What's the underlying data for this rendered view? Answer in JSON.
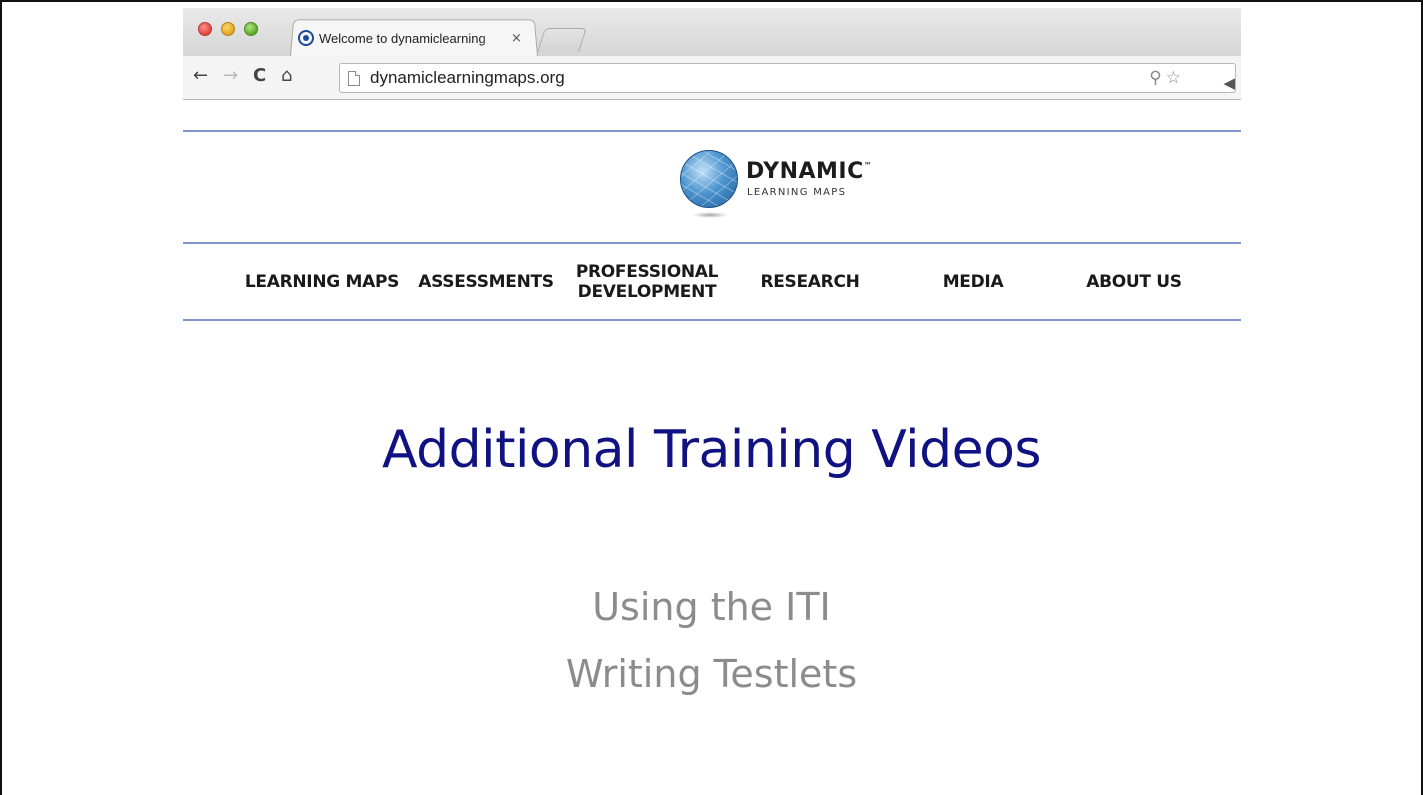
{
  "browser": {
    "tab_title": "Welcome to dynamiclearning",
    "tab_close": "×",
    "url": "dynamiclearningmaps.org",
    "icons": [
      "back-arrow-icon",
      "forward-arrow-icon",
      "reload-icon",
      "home-icon",
      "page-icon",
      "zoom-icon",
      "bookmark-star-icon",
      "audio-icon"
    ]
  },
  "site": {
    "logo_word": "DYNAMIC",
    "logo_tm": "™",
    "logo_sub": "LEARNING MAPS",
    "nav": [
      "LEARNING MAPS",
      "ASSESSMENTS",
      "PROFESSIONAL",
      "DEVELOPMENT",
      "RESEARCH",
      "MEDIA",
      "ABOUT US"
    ],
    "accent_color": "#7f95cf"
  },
  "slide": {
    "title": "Additional Training Videos",
    "title_color": "#0f1280",
    "subtitles": [
      "Using the ITI",
      "Writing Testlets"
    ],
    "subtitle_color": "#8c8c8c"
  }
}
